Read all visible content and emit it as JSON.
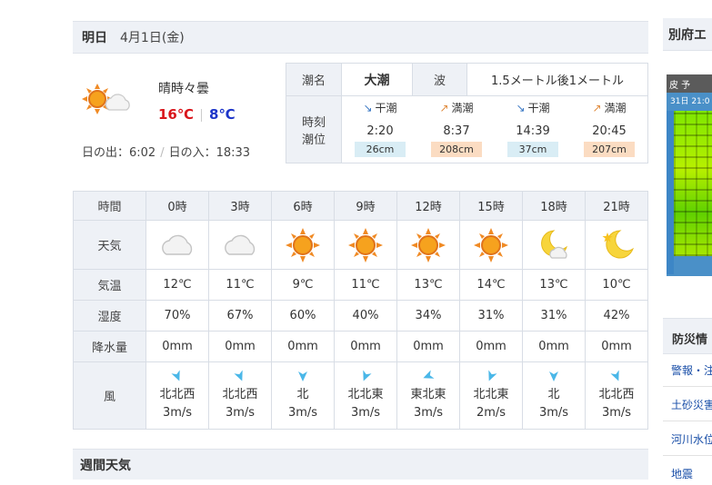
{
  "day": {
    "label": "明日",
    "date": "4月1日(金)"
  },
  "summary": {
    "weather_text": "晴時々曇",
    "high": "16℃",
    "low": "8℃",
    "icon": "sun-cloud-icon",
    "sunrise": "日の出：6:02",
    "sunset": "日の入：18:33"
  },
  "tide": {
    "name_label": "潮名",
    "name": "大潮",
    "wave_label": "波",
    "wave": "1.5メートル後1メートル",
    "time_label_1": "時刻",
    "time_label_2": "潮位",
    "events": [
      {
        "kind": "干潮",
        "dir": "down",
        "time": "2:20",
        "height": "26cm"
      },
      {
        "kind": "満潮",
        "dir": "up",
        "time": "8:37",
        "height": "208cm"
      },
      {
        "kind": "干潮",
        "dir": "down",
        "time": "14:39",
        "height": "37cm"
      },
      {
        "kind": "満潮",
        "dir": "up",
        "time": "20:45",
        "height": "207cm"
      }
    ]
  },
  "hourly": {
    "labels": {
      "time": "時間",
      "weather": "天気",
      "temp": "気温",
      "humidity": "湿度",
      "precip": "降水量",
      "wind": "風"
    },
    "hours": [
      "0時",
      "3時",
      "6時",
      "9時",
      "12時",
      "15時",
      "18時",
      "21時"
    ],
    "icons": [
      "cloud-icon",
      "cloud-icon",
      "sun-icon",
      "sun-icon",
      "sun-icon",
      "sun-icon",
      "moon-cloud-icon",
      "moon-star-icon"
    ],
    "temps": [
      "12℃",
      "11℃",
      "9℃",
      "11℃",
      "13℃",
      "14℃",
      "13℃",
      "10℃"
    ],
    "humidity": [
      "70%",
      "67%",
      "60%",
      "40%",
      "34%",
      "31%",
      "31%",
      "42%"
    ],
    "precip": [
      "0mm",
      "0mm",
      "0mm",
      "0mm",
      "0mm",
      "0mm",
      "0mm",
      "0mm"
    ],
    "wind_dir": [
      "北北西",
      "北北西",
      "北",
      "北北東",
      "東北東",
      "北北東",
      "北",
      "北北西"
    ],
    "wind_speed": [
      "3m/s",
      "3m/s",
      "3m/s",
      "3m/s",
      "3m/s",
      "2m/s",
      "3m/s",
      "3m/s"
    ]
  },
  "weekly": {
    "title": "週間天気"
  },
  "sidebar": {
    "map_title": "別府エ",
    "map_bar": "皮 予",
    "map_sub": "31日 21:0",
    "disaster_title": "防災情",
    "links": [
      "警報・注",
      "土砂災害",
      "河川水位",
      "地震"
    ]
  },
  "colors": {
    "header_bg": "#eef1f6",
    "high": "#d9161c",
    "low": "#1d35c9",
    "sun": "#f08a24",
    "wind_arrow": "#4ab7e8"
  }
}
